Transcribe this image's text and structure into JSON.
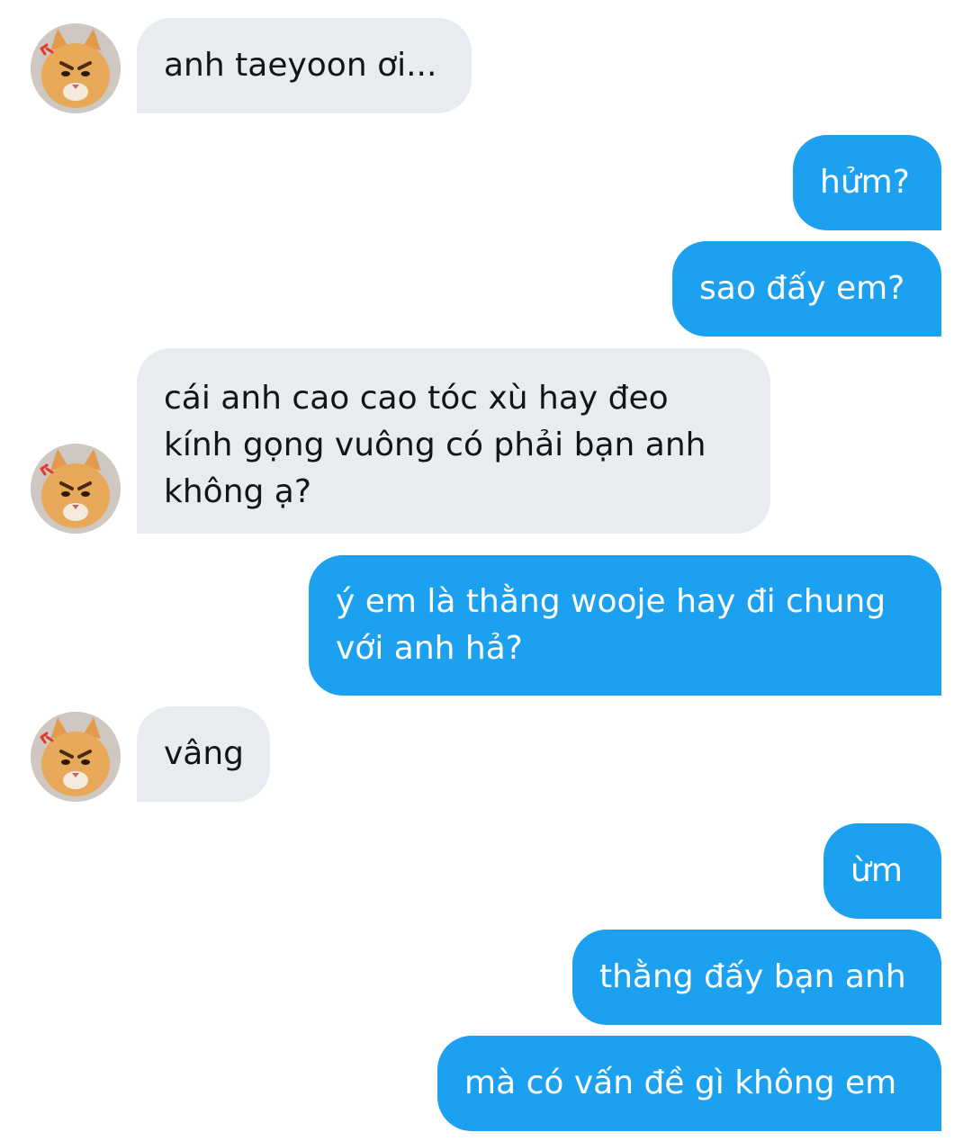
{
  "conversation": {
    "messages": [
      {
        "side": "incoming",
        "text": "anh taeyoon ơi..."
      },
      {
        "side": "outgoing",
        "text": "hửm?"
      },
      {
        "side": "outgoing",
        "text": "sao đấy em?"
      },
      {
        "side": "incoming",
        "text": "cái anh cao cao tóc xù hay đeo kính gọng vuông có phải bạn anh không ạ?"
      },
      {
        "side": "outgoing",
        "text": "ý em là thằng wooje hay đi chung với anh hả?"
      },
      {
        "side": "incoming",
        "text": "vâng"
      },
      {
        "side": "outgoing",
        "text": "ừm"
      },
      {
        "side": "outgoing",
        "text": "thằng đấy bạn anh"
      },
      {
        "side": "outgoing",
        "text": "mà có vấn đề gì không em"
      }
    ]
  },
  "avatar": {
    "icon": "angry-orange-cat-avatar-icon"
  },
  "colors": {
    "incoming_bubble": "#e8ebef",
    "outgoing_bubble": "#1ca0f0",
    "incoming_text": "#141414",
    "outgoing_text": "#ffffff"
  }
}
